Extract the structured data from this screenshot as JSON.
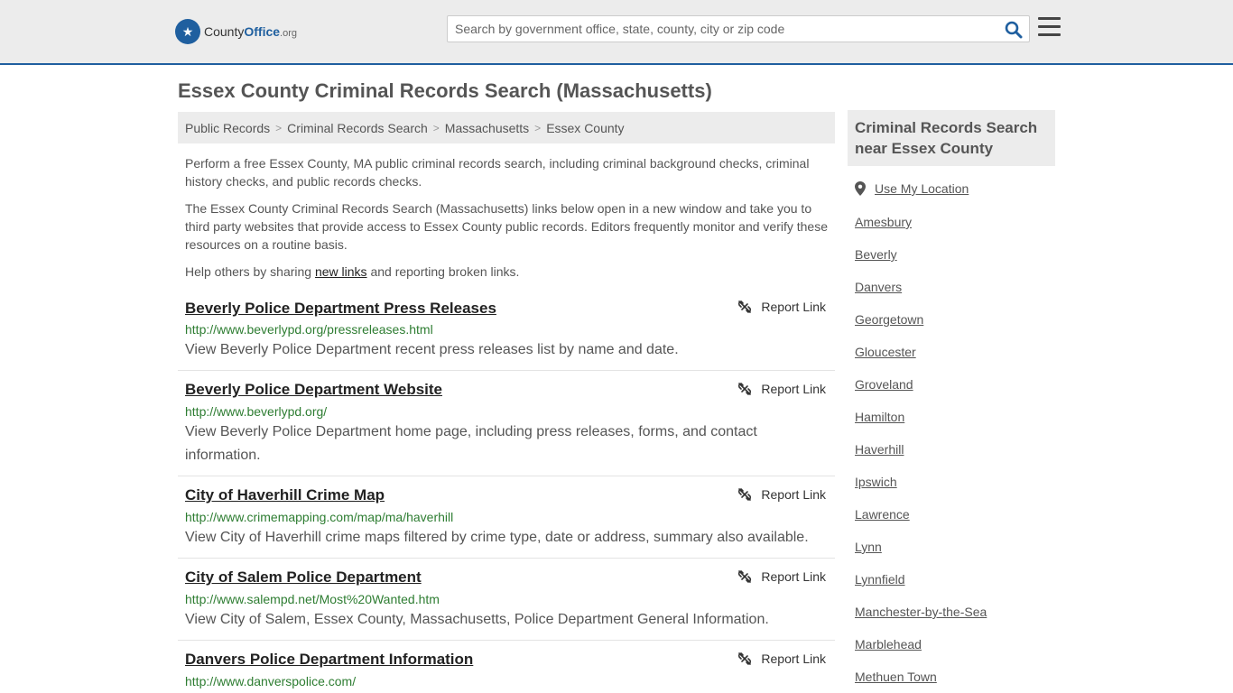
{
  "header": {
    "logo": {
      "part1": "County",
      "part2": "Office",
      "part3": ".org"
    },
    "search": {
      "placeholder": "Search by government office, state, county, city or zip code",
      "value": ""
    }
  },
  "page": {
    "title": "Essex County Criminal Records Search (Massachusetts)"
  },
  "breadcrumb": [
    "Public Records",
    "Criminal Records Search",
    "Massachusetts",
    "Essex County"
  ],
  "intro": {
    "p1": "Perform a free Essex County, MA public criminal records search, including criminal background checks, criminal history checks, and public records checks.",
    "p2": "The Essex County Criminal Records Search (Massachusetts) links below open in a new window and take you to third party websites that provide access to Essex County public records. Editors frequently monitor and verify these resources on a routine basis.",
    "p3_before": "Help others by sharing ",
    "p3_link": "new links",
    "p3_after": " and reporting broken links."
  },
  "report_label": "Report Link",
  "listings": [
    {
      "title": "Beverly Police Department Press Releases",
      "url": "http://www.beverlypd.org/pressreleases.html",
      "desc": "View Beverly Police Department recent press releases list by name and date."
    },
    {
      "title": "Beverly Police Department Website",
      "url": "http://www.beverlypd.org/",
      "desc": "View Beverly Police Department home page, including press releases, forms, and contact information."
    },
    {
      "title": "City of Haverhill Crime Map",
      "url": "http://www.crimemapping.com/map/ma/haverhill",
      "desc": "View City of Haverhill crime maps filtered by crime type, date or address, summary also available."
    },
    {
      "title": "City of Salem Police Department",
      "url": "http://www.salempd.net/Most%20Wanted.htm",
      "desc": "View City of Salem, Essex County, Massachusetts, Police Department General Information."
    },
    {
      "title": "Danvers Police Department Information",
      "url": "http://www.danverspolice.com/",
      "desc": ""
    }
  ],
  "sidebar": {
    "heading": "Criminal Records Search near Essex County",
    "use_location": "Use My Location",
    "links": [
      "Amesbury",
      "Beverly",
      "Danvers",
      "Georgetown",
      "Gloucester",
      "Groveland",
      "Hamilton",
      "Haverhill",
      "Ipswich",
      "Lawrence",
      "Lynn",
      "Lynnfield",
      "Manchester-by-the-Sea",
      "Marblehead",
      "Methuen Town"
    ]
  },
  "colors": {
    "brand": "#1f5f9f",
    "url_green": "#2e7d32",
    "panel_gray": "#ececec"
  }
}
